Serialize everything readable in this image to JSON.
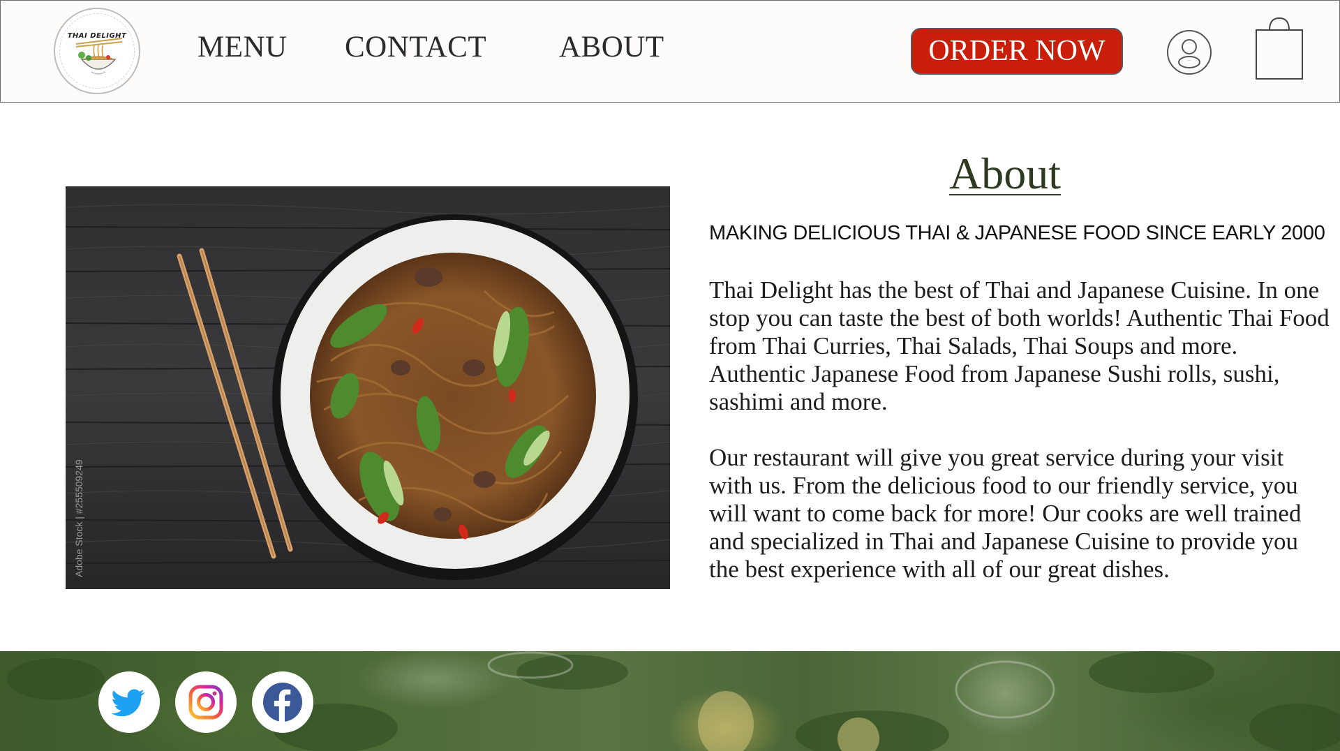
{
  "header": {
    "logo_text": "THAI DELIGHT",
    "nav": [
      {
        "label": "MENU"
      },
      {
        "label": "CONTACT"
      },
      {
        "label": "ABOUT"
      }
    ],
    "order_button": "ORDER NOW",
    "accent_color": "#c81e0a"
  },
  "main": {
    "image_watermark": "Adobe Stock | #255509249",
    "title": "About",
    "tagline": "MAKING DELICIOUS THAI & JAPANESE FOOD SINCE EARLY 2000",
    "paragraphs": [
      "Thai Delight has the best of Thai and Japanese Cuisine. In one stop you can taste the best of both worlds! Authentic Thai Food from Thai Curries, Thai Salads, Thai Soups and more. Authentic Japanese Food from Japanese Sushi rolls, sushi, sashimi and more.",
      "Our restaurant will give you great service during your visit with us. From the delicious food to our friendly service, you will want to come back for more! Our cooks are well trained and specialized in Thai and Japanese Cuisine to provide you the best experience with all of our great dishes."
    ]
  },
  "footer": {
    "social": [
      {
        "icon": "twitter-icon",
        "color": "#1da1f2"
      },
      {
        "icon": "instagram-icon",
        "color": "#d6249f"
      },
      {
        "icon": "facebook-icon",
        "color": "#3b5998"
      }
    ]
  }
}
